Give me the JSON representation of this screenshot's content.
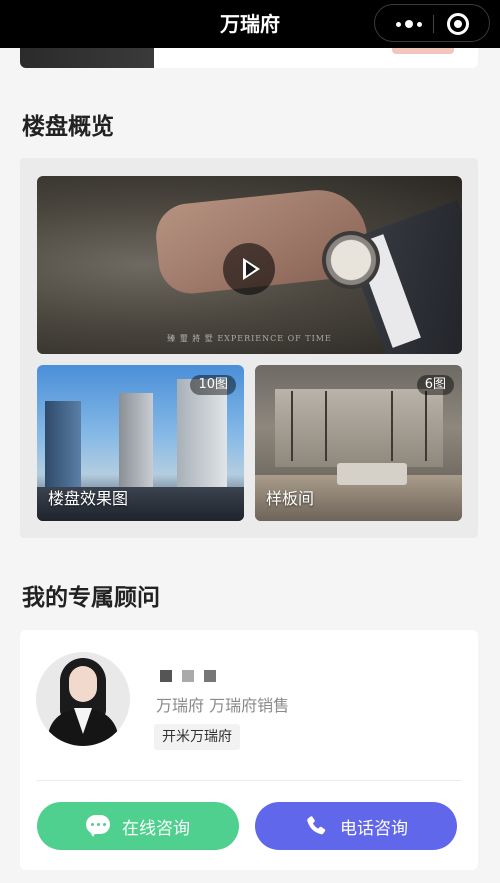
{
  "window": {
    "title": "万瑞府"
  },
  "sections": {
    "overview_title": "楼盘概览",
    "advisor_title": "我的专属顾问"
  },
  "overview": {
    "video_caption": "臻 璽 將 墅   EXPERIENCE OF TIME",
    "tiles": [
      {
        "label": "楼盘效果图",
        "count": "10图"
      },
      {
        "label": "样板间",
        "count": "6图"
      }
    ]
  },
  "advisor": {
    "name_mask_colors": [
      "#555555",
      "#aaaaaa",
      "#777777"
    ],
    "company": "万瑞府  万瑞府销售",
    "tag": "开米万瑞府",
    "chat_button": "在线咨询",
    "call_button": "电话咨询"
  },
  "icons": {
    "more": "more-dots-icon",
    "target": "target-icon",
    "play": "play-icon",
    "chat": "chat-bubble-icon",
    "phone": "phone-icon"
  },
  "colors": {
    "chat": "#4fd08f",
    "call": "#6067ea"
  }
}
